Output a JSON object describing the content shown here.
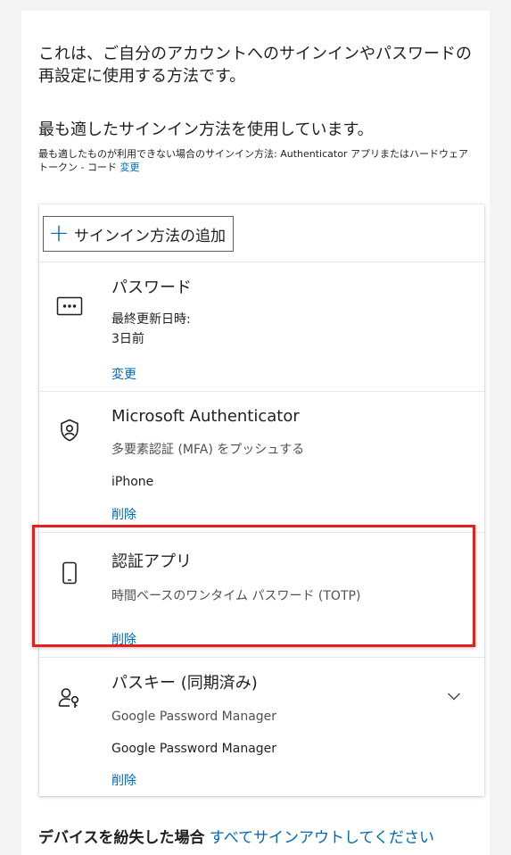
{
  "intro_text": "これは、ご自分のアカウントへのサインインやパスワードの再設定に使用する方法です。",
  "best_method_text": "最も適したサインイン方法を使用しています。",
  "fallback": {
    "prefix": "最も適したものが利用できない場合のサインイン方法: Authenticator アプリまたはハードウェア トークン - コード",
    "change_link": "変更"
  },
  "add_method_button": {
    "plus": "+",
    "label": "サインイン方法の追加"
  },
  "methods": [
    {
      "icon": "password-dots-icon",
      "title": "パスワード",
      "line1": "最終更新日時:",
      "line2": "3日前",
      "action": "変更"
    },
    {
      "icon": "microsoft-authenticator-icon",
      "title": "Microsoft Authenticator",
      "line1": "多要素認証 (MFA) をプッシュする",
      "line2": "iPhone",
      "action": "削除"
    },
    {
      "icon": "phone-icon",
      "title": "認証アプリ",
      "line1": "時間ベースのワンタイム パスワード (TOTP)",
      "action": "削除"
    },
    {
      "icon": "passkey-icon",
      "title": "パスキー (同期済み)",
      "line1": "Google Password Manager",
      "line2": "Google Password Manager",
      "action": "削除"
    }
  ],
  "lost_device": {
    "label": "デバイスを紛失した場合",
    "link": "すべてサインアウトしてください"
  },
  "colors": {
    "link": "#0067b8",
    "highlight_border": "#e41f1f",
    "background": "#f3f3f3"
  }
}
